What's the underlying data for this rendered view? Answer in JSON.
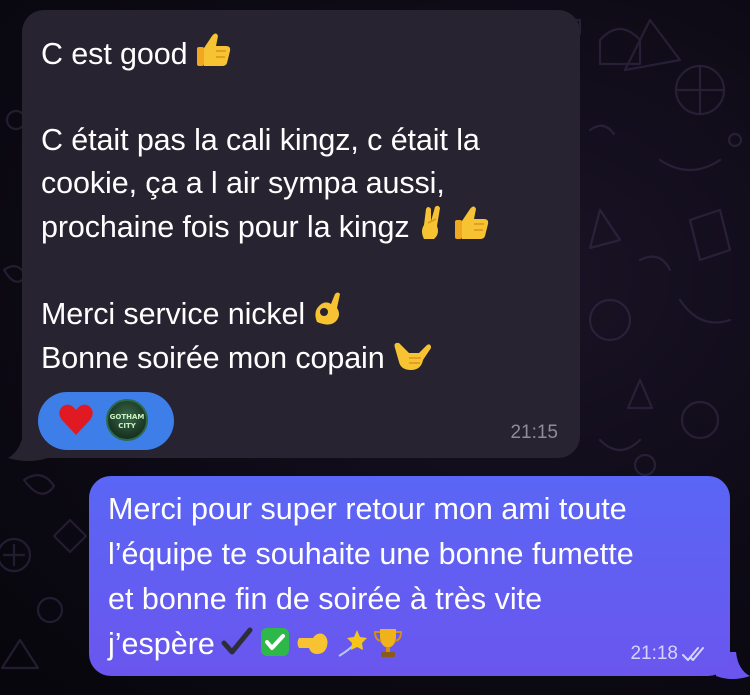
{
  "incoming": {
    "lines": [
      "C est good",
      "C était pas la cali kingz, c était la",
      "cookie, ça a l air sympa aussi,",
      "prochaine fois pour la kingz",
      "Merci service nickel",
      "Bonne soirée mon copain"
    ],
    "reactions": {
      "heart": "heart-emoji",
      "avatar_text_1": "GOTHAM",
      "avatar_text_2": "CITY"
    },
    "time": "21:15"
  },
  "outgoing": {
    "lines": [
      "Merci pour super retour mon ami toute",
      "l’équipe te souhaite une bonne fumette",
      "et bonne fin de soirée à très vite",
      "j’espère"
    ],
    "time": "21:18",
    "status": "read-double-check-icon"
  },
  "colors": {
    "incoming_bubble": "#272330",
    "outgoing_bubble": "#5a66f5",
    "reaction_pill": "#3d7ee8"
  }
}
